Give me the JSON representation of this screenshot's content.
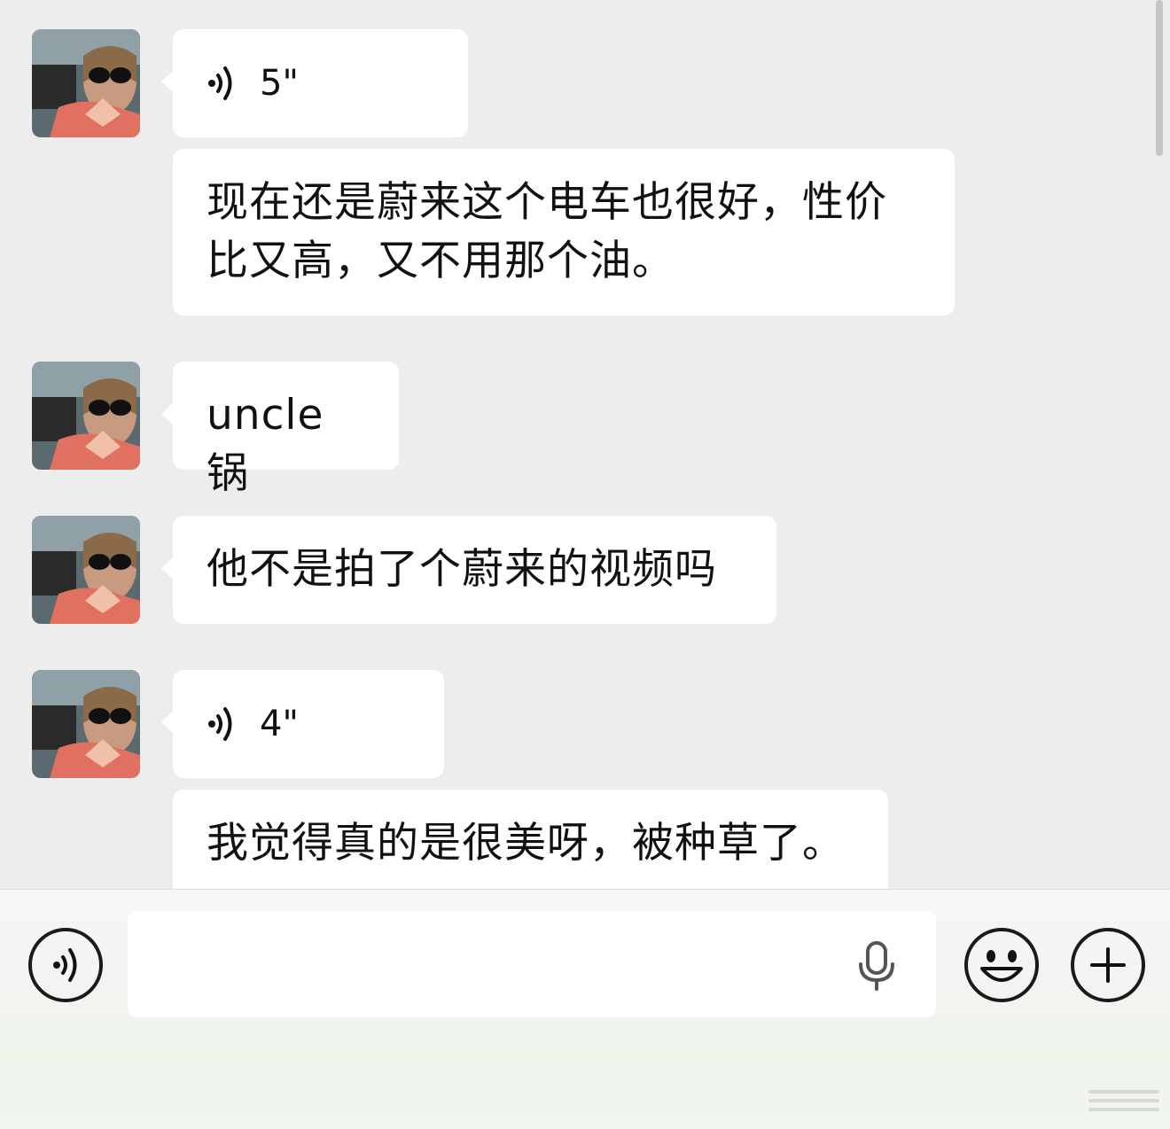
{
  "messages": [
    {
      "type": "voice",
      "duration": "5\""
    },
    {
      "type": "text",
      "lines": [
        "现在还是蔚来这个电车也很好，性价",
        "比又高，又不用那个油。"
      ]
    },
    {
      "type": "text",
      "lines": [
        "uncle 锅"
      ]
    },
    {
      "type": "text",
      "lines": [
        "他不是拍了个蔚来的视频吗"
      ]
    },
    {
      "type": "voice",
      "duration": "4\""
    },
    {
      "type": "text",
      "lines": [
        "我觉得真的是很美呀，被种草了。"
      ]
    }
  ],
  "input": {
    "value": "",
    "placeholder": ""
  },
  "icons": {
    "voice_toggle": "voice-wave-icon",
    "mic": "microphone-icon",
    "emoji": "smiley-icon",
    "more": "plus-icon"
  },
  "colors": {
    "background": "#ededed",
    "bubble": "#ffffff",
    "text": "#111111"
  }
}
